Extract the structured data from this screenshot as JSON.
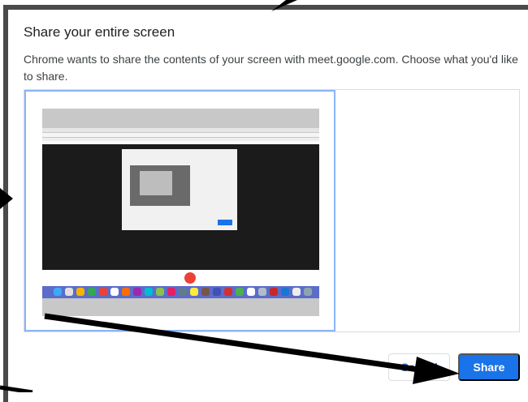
{
  "dialog": {
    "title": "Share your entire screen",
    "description": "Chrome wants to share the contents of your screen with meet.google.com. Choose what you'd like to share."
  },
  "buttons": {
    "cancel_label": "Cancel",
    "share_label": "Share"
  },
  "colors": {
    "accent": "#1a73e8",
    "arrow": "#000000",
    "frame": "#4a4a4a"
  }
}
